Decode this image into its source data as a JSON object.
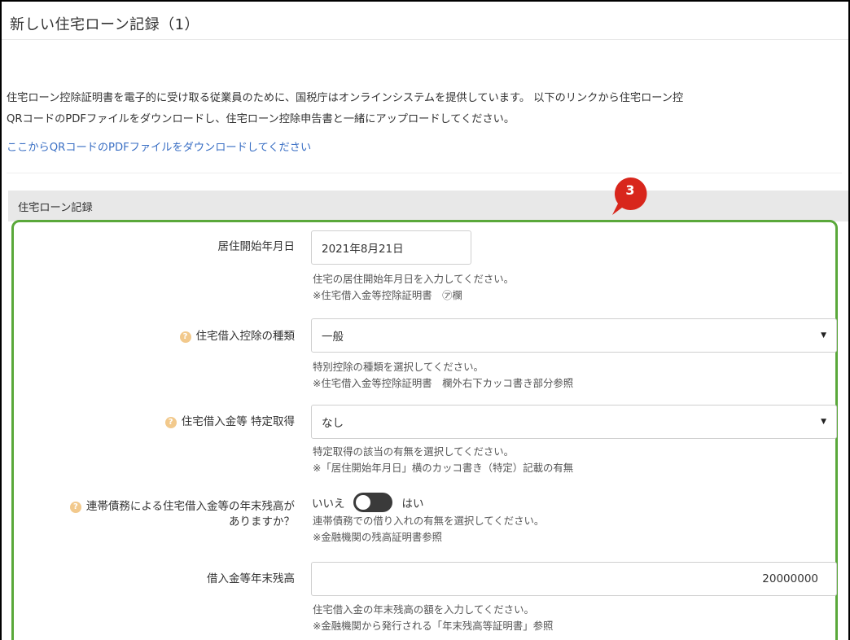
{
  "page": {
    "title": "新しい住宅ローン記録（1）",
    "intro_line1": "住宅ローン控除証明書を電子的に受け取る従業員のために、国税庁はオンラインシステムを提供しています。 以下のリンクから住宅ローン控",
    "intro_line2": "QRコードのPDFファイルをダウンロードし、住宅ローン控除申告書と一緒にアップロードしてください。",
    "download_link": "ここからQRコードのPDFファイルをダウンロードしてください"
  },
  "section": {
    "title": "住宅ローン記録",
    "badge_number": "3",
    "highlight_color": "#5aa83a",
    "badge_color": "#d8261c"
  },
  "fields": {
    "move_in_date": {
      "label": "居住開始年月日",
      "value": "2021年8月21日",
      "help1": "住宅の居住開始年月日を入力してください。",
      "help2": "※住宅借入金等控除証明書　㋐欄"
    },
    "deduction_type": {
      "label": "住宅借入控除の種類",
      "value": "一般",
      "help1": "特別控除の種類を選択してください。",
      "help2": "※住宅借入金等控除証明書　欄外右下カッコ書き部分参照"
    },
    "specific_acquisition": {
      "label": "住宅借入金等 特定取得",
      "value": "なし",
      "help1": "特定取得の該当の有無を選択してください。",
      "help2": "※「居住開始年月日」横のカッコ書き（特定）記載の有無"
    },
    "joint_debt": {
      "label_line1": "連帯債務による住宅借入金等の年末残高が",
      "label_line2": "ありますか？",
      "option_no": "いいえ",
      "option_yes": "はい",
      "help1": "連帯債務での借り入れの有無を選択してください。",
      "help2": "※金融機関の残高証明書参照"
    },
    "year_end_balance": {
      "label": "借入金等年末残高",
      "value": "20000000",
      "help1": "住宅借入金の年末残高の額を入力してください。",
      "help2": "※金融機関から発行される「年末残高等証明書」参照"
    }
  },
  "icons": {
    "help": "question-circle-icon",
    "dropdown": "caret-down-icon"
  }
}
